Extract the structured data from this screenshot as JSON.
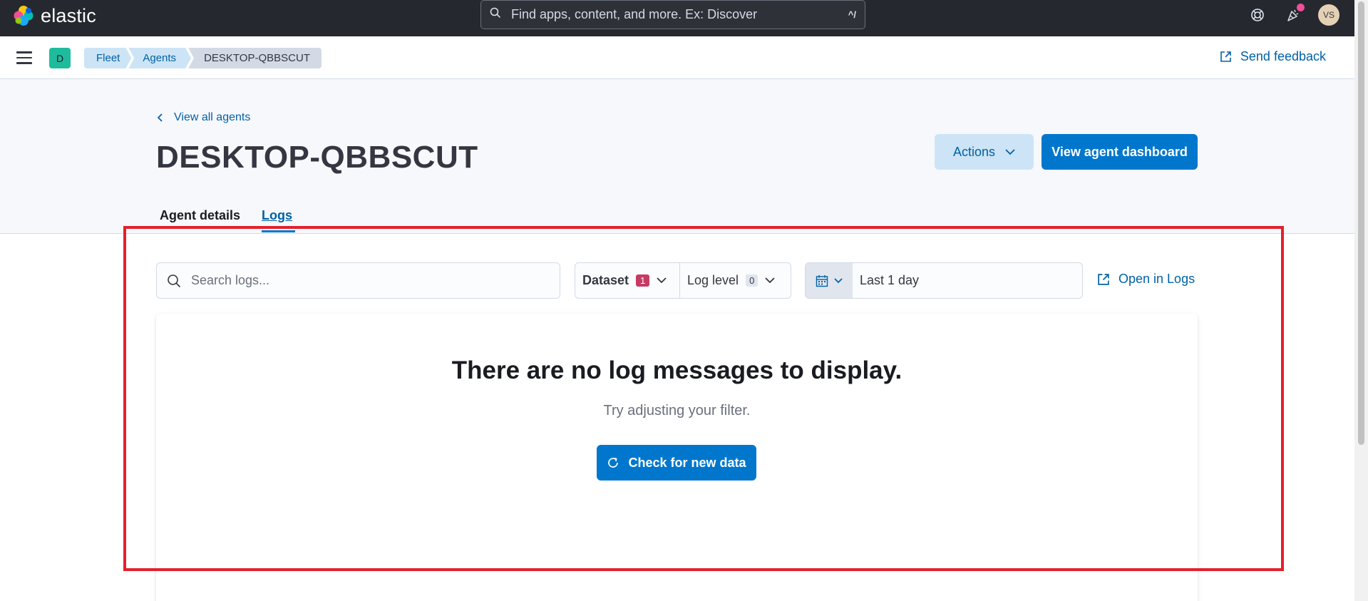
{
  "header": {
    "logo_text": "elastic",
    "search_placeholder": "Find apps, content, and more. Ex: Discover",
    "search_shortcut": "^/",
    "avatar_initials": "VS",
    "notification_color": "#f04e98"
  },
  "subbar": {
    "space_initial": "D",
    "breadcrumbs": [
      "Fleet",
      "Agents",
      "DESKTOP-QBBSCUT"
    ],
    "feedback_label": "Send feedback"
  },
  "page": {
    "back_link": "View all agents",
    "title": "DESKTOP-QBBSCUT",
    "actions_label": "Actions",
    "dashboard_label": "View agent dashboard",
    "tabs": [
      "Agent details",
      "Logs"
    ],
    "active_tab": "Logs"
  },
  "logs": {
    "search_placeholder": "Search logs...",
    "dataset_label": "Dataset",
    "dataset_count": "1",
    "level_label": "Log level",
    "level_count": "0",
    "date_range": "Last 1 day",
    "open_logs_label": "Open in Logs",
    "empty_title": "There are no log messages to display.",
    "empty_body": "Try adjusting your filter.",
    "check_button": "Check for new data"
  },
  "colors": {
    "header_bg": "#25282f",
    "primary": "#0077cc",
    "link": "#0061a6",
    "highlight_frame": "#e3202c"
  }
}
